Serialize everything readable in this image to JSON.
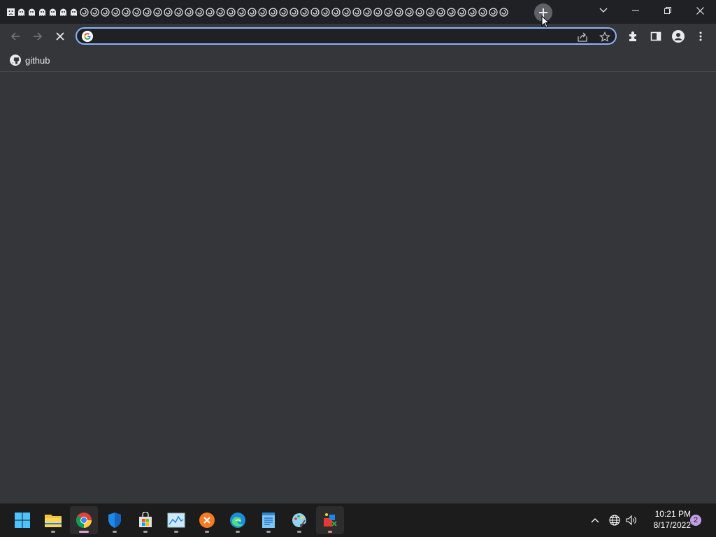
{
  "browser": {
    "tab_strip": {
      "tab_favicons": [
        "sad-face-icon",
        "ghost-icon",
        "ghost-icon",
        "ghost-icon",
        "ghost-icon",
        "ghost-icon",
        "ghost-icon",
        "spiral-icon",
        "spiral-icon",
        "spiral-icon",
        "spiral-icon",
        "spiral-icon",
        "spiral-icon",
        "spiral-icon",
        "spiral-icon",
        "spiral-icon",
        "spiral-icon",
        "spiral-icon",
        "spiral-icon",
        "spiral-icon",
        "spiral-icon",
        "spiral-icon",
        "spiral-icon",
        "spiral-icon",
        "spiral-icon",
        "spiral-icon",
        "spiral-icon",
        "spiral-icon",
        "spiral-icon",
        "spiral-icon",
        "spiral-icon",
        "spiral-icon",
        "spiral-icon",
        "spiral-icon",
        "spiral-icon",
        "spiral-icon",
        "spiral-icon",
        "spiral-icon",
        "spiral-icon",
        "spiral-icon",
        "spiral-icon",
        "spiral-icon",
        "spiral-icon",
        "spiral-icon",
        "spiral-icon",
        "spiral-icon",
        "spiral-icon",
        "spiral-icon"
      ],
      "new_tab_icon": "plus-icon"
    },
    "window_controls": [
      "chevron-down-icon",
      "minimize-icon",
      "restore-icon",
      "close-icon"
    ],
    "omnibox": {
      "value": "",
      "placeholder": ""
    },
    "bookmarks": [
      {
        "label": "github",
        "icon": "github-icon"
      }
    ],
    "loading": true
  },
  "taskbar": {
    "apps": [
      "start",
      "file-explorer",
      "chrome",
      "windows-security",
      "microsoft-store",
      "task-manager",
      "xampp",
      "edge",
      "notepad",
      "paint",
      "app"
    ],
    "clock": {
      "time": "10:21 PM",
      "date": "8/17/2022"
    },
    "notification_count": "2"
  },
  "colors": {
    "titlebar": "#202124",
    "toolbar": "#35363a",
    "accent": "#8ab4f8",
    "taskbar": "#1c1c1c"
  }
}
